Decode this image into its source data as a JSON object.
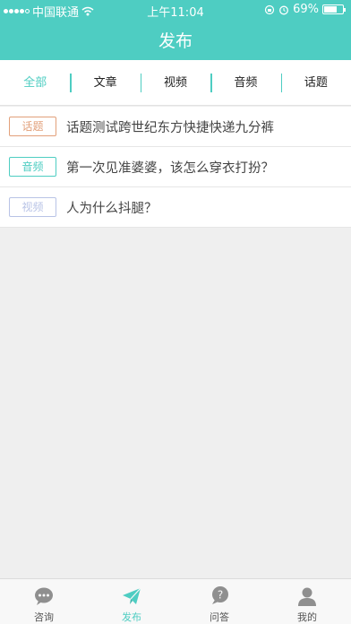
{
  "status_bar": {
    "carrier": "中国联通",
    "time": "上午11:04",
    "battery": "69%",
    "battery_level": 0.69
  },
  "header": {
    "title": "发布"
  },
  "tabs": [
    {
      "label": "全部",
      "active": true
    },
    {
      "label": "文章",
      "active": false
    },
    {
      "label": "视频",
      "active": false
    },
    {
      "label": "音频",
      "active": false
    },
    {
      "label": "话题",
      "active": false
    }
  ],
  "items": [
    {
      "tag": "话题",
      "tag_color": "#e2a07a",
      "title": "话题测试跨世纪东方快捷快递九分裤"
    },
    {
      "tag": "音频",
      "tag_color": "#4ecdc2",
      "title": "第一次见准婆婆，该怎么穿衣打扮？"
    },
    {
      "tag": "视频",
      "tag_color": "#b8c3e6",
      "title": "人为什么抖腿？"
    }
  ],
  "bottom_nav": [
    {
      "label": "咨询",
      "icon": "chat-bubble-icon",
      "active": false
    },
    {
      "label": "发布",
      "icon": "paper-plane-icon",
      "active": true
    },
    {
      "label": "问答",
      "icon": "question-bubble-icon",
      "active": false
    },
    {
      "label": "我的",
      "icon": "person-icon",
      "active": false
    }
  ],
  "colors": {
    "accent": "#4ecdc2",
    "background": "#efefef"
  }
}
